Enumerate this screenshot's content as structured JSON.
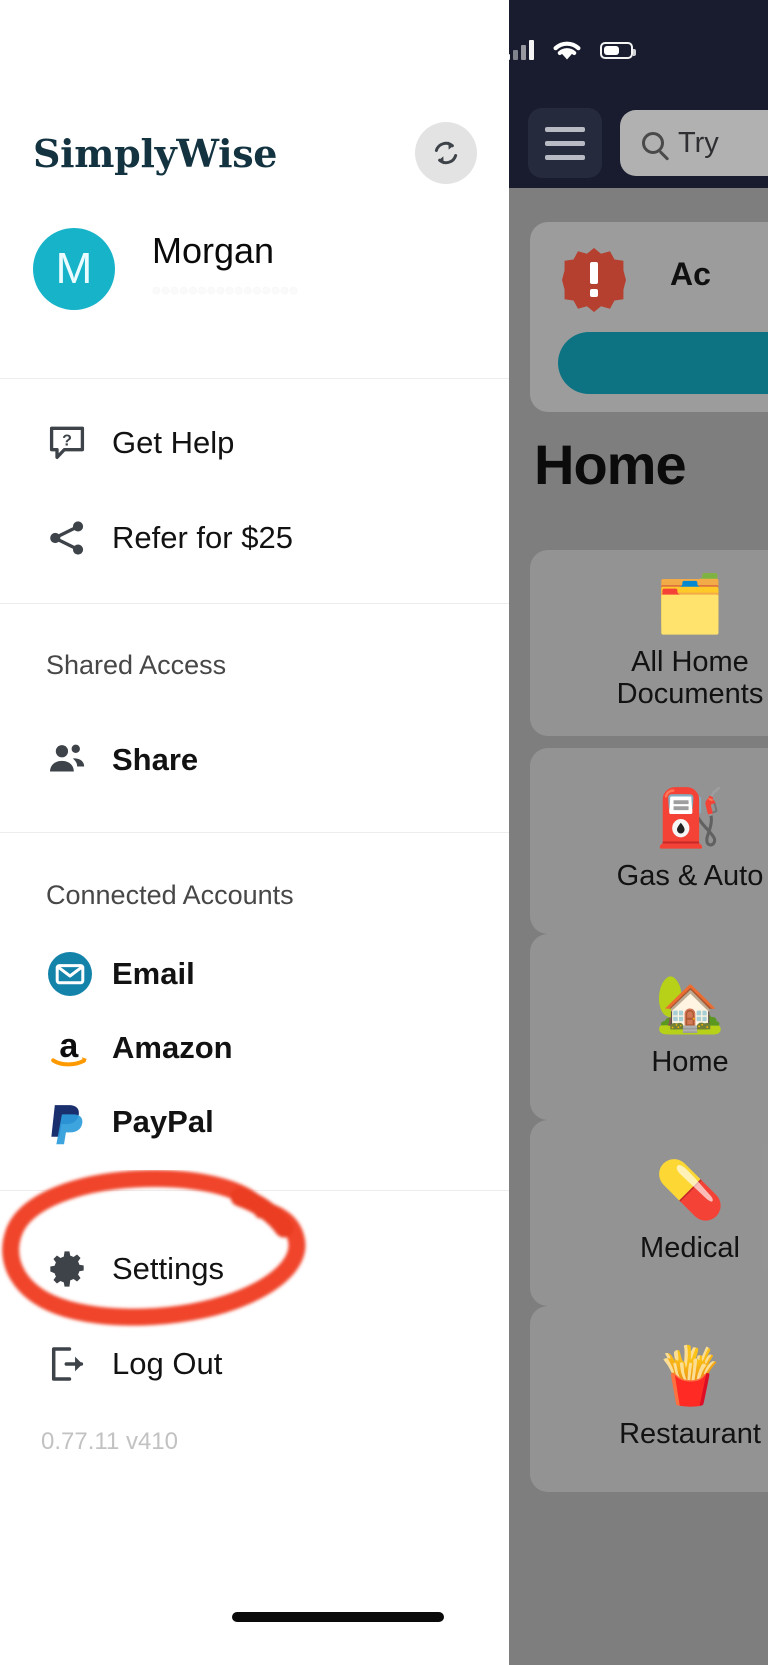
{
  "drawer": {
    "brand": "SimplyWise",
    "sync_icon": "sync-icon",
    "profile": {
      "avatar_initial": "M",
      "name": "Morgan",
      "email_redacted": "••••••••••••••••",
      "avatar_color": "#17b3c9"
    },
    "support_items": [
      {
        "label": "Get Help",
        "icon": "help-chat-icon"
      },
      {
        "label": "Refer for $25",
        "icon": "share-nodes-icon"
      }
    ],
    "shared_access": {
      "section_title": "Shared Access",
      "items": [
        {
          "label": "Share",
          "icon": "people-icon"
        }
      ]
    },
    "connected_accounts": {
      "section_title": "Connected Accounts",
      "items": [
        {
          "label": "Email",
          "icon": "email-envelope-icon",
          "color": "#1383aa"
        },
        {
          "label": "Amazon",
          "icon": "amazon-logo-icon",
          "color": "#ff9900"
        },
        {
          "label": "PayPal",
          "icon": "paypal-logo-icon",
          "color": "#1a2f6e"
        }
      ]
    },
    "footer_items": [
      {
        "label": "Settings",
        "icon": "gear-icon"
      },
      {
        "label": "Log Out",
        "icon": "logout-arrow-icon"
      }
    ],
    "version": "0.77.11 v410",
    "annotation": {
      "type": "red-circle-highlight",
      "target": "Settings",
      "color": "#f0442b"
    }
  },
  "background_app": {
    "status_bar": {
      "signal_icon": "cellular-signal-icon",
      "wifi_icon": "wifi-icon",
      "battery_icon": "battery-icon"
    },
    "header": {
      "menu_icon": "hamburger-menu-icon",
      "search_icon": "search-icon",
      "search_placeholder": "Try"
    },
    "alert_card": {
      "icon": "alert-burst-icon",
      "title": "Ac",
      "button_label": "",
      "button_color": "#0d7383"
    },
    "page_title": "Home",
    "tiles": [
      {
        "label": "All Home\nDocuments",
        "emoji": "🗂️"
      },
      {
        "label": "Gas & Auto",
        "emoji": "⛽"
      },
      {
        "label": "Home",
        "emoji": "🏡"
      },
      {
        "label": "Medical",
        "emoji": "💊"
      },
      {
        "label": "Restaurant",
        "emoji": "🍟"
      }
    ]
  }
}
